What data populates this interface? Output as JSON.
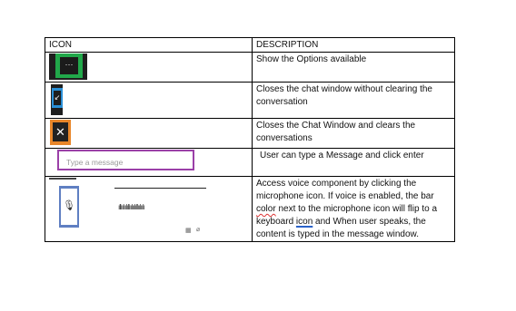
{
  "table": {
    "headers": [
      "ICON",
      "DESCRIPTION"
    ],
    "rows": [
      {
        "icon_name": "options-icon",
        "icon_glyph": "···",
        "icon_color": "#21a84a",
        "description": "Show the Options available"
      },
      {
        "icon_name": "minimize-icon",
        "icon_glyph": "↙",
        "icon_color": "#2a8fd6",
        "description": "Closes the chat window without clearing the conversation"
      },
      {
        "icon_name": "close-icon",
        "icon_glyph": "✕",
        "icon_color": "#e8862a",
        "description": "Closes the Chat Window and clears the conversations"
      },
      {
        "icon_name": "message-input",
        "icon_color": "#9b40a8",
        "placeholder": "Type a message",
        "description": "User can type a Message and click enter"
      },
      {
        "icon_name": "microphone-icon",
        "icon_glyph": "🎙",
        "icon_color": "#5f7fc2",
        "waveform": "ıllıılıılıllıılıılıllıılıılı",
        "description_parts": {
          "p1": "Access voice component by clicking the microphone icon. If voice is enabled, the bar ",
          "color_word": "color",
          "p2": " next to the microphone icon will flip to a keyboard ",
          "icon_word": "icon",
          "p3": "  and  When user speaks, the content is typed in the message window."
        }
      }
    ]
  }
}
